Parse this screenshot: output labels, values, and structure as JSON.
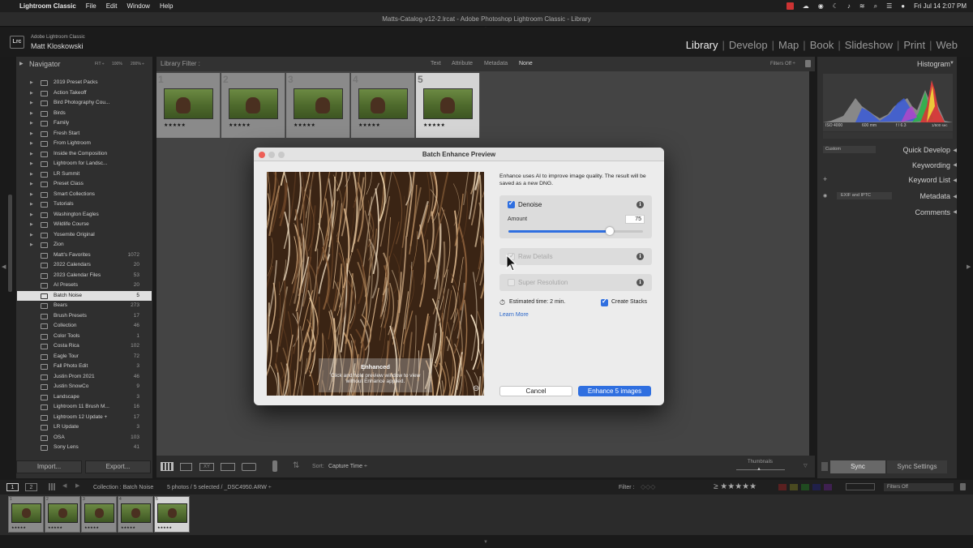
{
  "menubar": {
    "apple": "",
    "app": "Lightroom Classic",
    "items": [
      "File",
      "Edit",
      "Window",
      "Help"
    ],
    "clock": "Fri Jul 14  2:07 PM"
  },
  "window": {
    "title": "Matts-Catalog-v12-2.lrcat - Adobe Photoshop Lightroom Classic - Library"
  },
  "identity": {
    "logo": "Lrc",
    "product": "Adobe Lightroom Classic",
    "user": "Matt Kloskowski"
  },
  "modules": [
    "Library",
    "Develop",
    "Map",
    "Book",
    "Slideshow",
    "Print",
    "Web"
  ],
  "left": {
    "navigator": "Navigator",
    "zoom": [
      "FIT ÷",
      "100%",
      "200% ÷"
    ],
    "collections": [
      {
        "name": "2019 Preset Packs",
        "count": ""
      },
      {
        "name": "Action Takeoff",
        "count": ""
      },
      {
        "name": "Bird Photography Cou...",
        "count": ""
      },
      {
        "name": "Birds",
        "count": ""
      },
      {
        "name": "Family",
        "count": ""
      },
      {
        "name": "Fresh Start",
        "count": ""
      },
      {
        "name": "From Lightroom",
        "count": ""
      },
      {
        "name": "Inside the Composition",
        "count": ""
      },
      {
        "name": "Lightroom for Landsc...",
        "count": ""
      },
      {
        "name": "LR Summit",
        "count": ""
      },
      {
        "name": "Preset Class",
        "count": ""
      },
      {
        "name": "Smart Collections",
        "count": ""
      },
      {
        "name": "Tutorials",
        "count": ""
      },
      {
        "name": "Washington Eagles",
        "count": ""
      },
      {
        "name": "Wildlife Course",
        "count": ""
      },
      {
        "name": "Yosemite Original",
        "count": ""
      },
      {
        "name": "Zion",
        "count": ""
      },
      {
        "name": "Matt's Favorites",
        "count": "1072"
      },
      {
        "name": "2022 Calendars",
        "count": "20"
      },
      {
        "name": "2023 Calendar Files",
        "count": "53"
      },
      {
        "name": "AI Presets",
        "count": "20"
      },
      {
        "name": "Batch Noise",
        "count": "5"
      },
      {
        "name": "Bears",
        "count": "273"
      },
      {
        "name": "Brush Presets",
        "count": "17"
      },
      {
        "name": "Collection",
        "count": "46"
      },
      {
        "name": "Color Tools",
        "count": "1"
      },
      {
        "name": "Costa Rica",
        "count": "102"
      },
      {
        "name": "Eagle Tour",
        "count": "72"
      },
      {
        "name": "Fall Photo Edit",
        "count": "3"
      },
      {
        "name": "Justin Prom 2021",
        "count": "46"
      },
      {
        "name": "Justin SnowCo",
        "count": "9"
      },
      {
        "name": "Landscape",
        "count": "3"
      },
      {
        "name": "Lightroom 11 Brush M...",
        "count": "16"
      },
      {
        "name": "Lightroom 12 Update +",
        "count": "17"
      },
      {
        "name": "LR Update",
        "count": "3"
      },
      {
        "name": "OSA",
        "count": "103"
      },
      {
        "name": "Sony Lens",
        "count": "41"
      }
    ],
    "selected_index": 21,
    "import": "Import...",
    "export": "Export..."
  },
  "filterbar": {
    "label": "Library Filter :",
    "tabs": [
      "Text",
      "Attribute",
      "Metadata",
      "None"
    ],
    "status": "Filters Off ÷"
  },
  "grid": {
    "cells": [
      {
        "num": "1",
        "stars": "★★★★★"
      },
      {
        "num": "2",
        "stars": "★★★★★"
      },
      {
        "num": "3",
        "stars": "★★★★★"
      },
      {
        "num": "4",
        "stars": "★★★★★"
      },
      {
        "num": "5",
        "stars": "★★★★★"
      }
    ]
  },
  "toolbar": {
    "sort_label": "Sort:",
    "sort_value": "Capture Time ÷",
    "thumbnails": "Thumbnails"
  },
  "right": {
    "histogram": "Histogram",
    "meta": [
      "ISO 4000",
      "600 mm",
      "f / 6.3",
      "1/500 sec"
    ],
    "quick_develop": "Quick Develop",
    "preset": "Custom",
    "keywording": "Keywording",
    "keyword_list": "Keyword List",
    "metadata": "Metadata",
    "metadata_preset": "EXIF and IPTC",
    "comments": "Comments",
    "sync": "Sync",
    "sync_settings": "Sync Settings"
  },
  "filmstrip": {
    "page1": "1",
    "page2": "2",
    "collection": "Collection : Batch Noise",
    "selection": "5 photos / 5 selected / _DSC4950.ARW ÷",
    "filter_label": "Filter :",
    "filters_off": "Filters Off",
    "stars": "≥ ★★★★★"
  },
  "dialog": {
    "title": "Batch Enhance Preview",
    "description": "Enhance uses AI to improve image quality. The result will be saved as a new DNG.",
    "denoise": {
      "label": "Denoise",
      "checked": true
    },
    "amount": {
      "label": "Amount",
      "value": "75",
      "fraction": 0.75
    },
    "raw_details": {
      "label": "Raw Details",
      "checked": true,
      "disabled": true
    },
    "super_resolution": {
      "label": "Super Resolution",
      "checked": false,
      "disabled": true
    },
    "estimated": "Estimated time: 2 min.",
    "create_stacks": "Create Stacks",
    "learn_more": "Learn More",
    "preview_title": "Enhanced",
    "preview_hint": "Click and hold preview window to view without Enhance applied.",
    "cancel": "Cancel",
    "enhance": "Enhance 5 images"
  },
  "colors": {
    "accent": "#2f6fe0",
    "selected_collection": "#e0e0e0"
  }
}
